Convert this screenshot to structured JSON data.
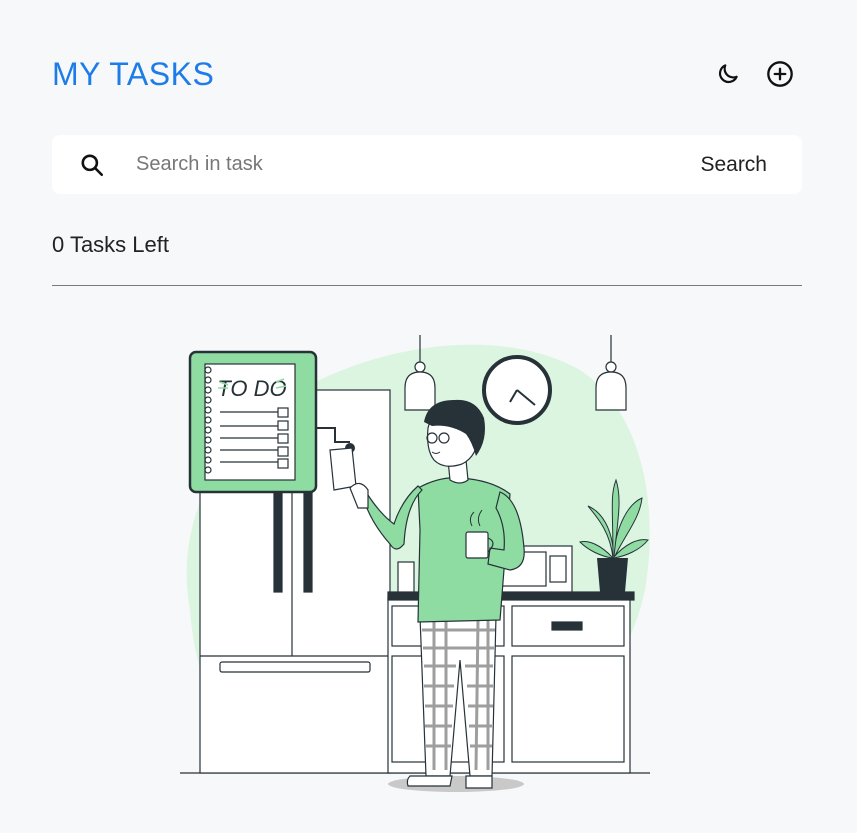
{
  "header": {
    "title": "MY TASKS"
  },
  "icons": {
    "theme_toggle": "moon-icon",
    "add_task": "plus-circle-icon",
    "search": "search-icon"
  },
  "search": {
    "placeholder": "Search in task",
    "value": "",
    "button_label": "Search"
  },
  "tasks": {
    "left_label": "0 Tasks Left",
    "items": []
  },
  "illustration": {
    "board_text": "TO DO"
  },
  "colors": {
    "accent": "#1e7ce8",
    "background": "#f7f8fa",
    "illustration_green": "#8fdca3",
    "illustration_blob": "#dcf5e1",
    "ink": "#263238"
  }
}
